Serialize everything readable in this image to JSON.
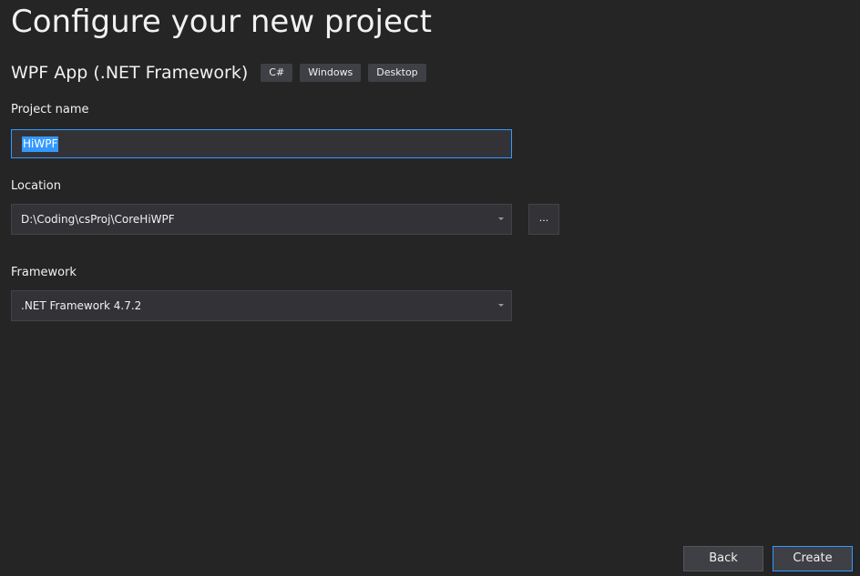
{
  "page": {
    "title": "Configure your new project"
  },
  "template": {
    "name": "WPF App (.NET Framework)",
    "tags": [
      "C#",
      "Windows",
      "Desktop"
    ]
  },
  "fields": {
    "project_name": {
      "label": "Project name",
      "value": "HiWPF"
    },
    "location": {
      "label": "Location",
      "value": "D:\\Coding\\csProj\\CoreHiWPF",
      "browse_label": "..."
    },
    "framework": {
      "label": "Framework",
      "value": ".NET Framework 4.7.2"
    }
  },
  "footer": {
    "back_label": "Back",
    "create_label": "Create"
  },
  "colors": {
    "background": "#252526",
    "input_background": "#333337",
    "accent": "#3399ff",
    "tag_background": "#3f3f46"
  },
  "icons": {
    "dropdown": "chevron-down-icon"
  }
}
